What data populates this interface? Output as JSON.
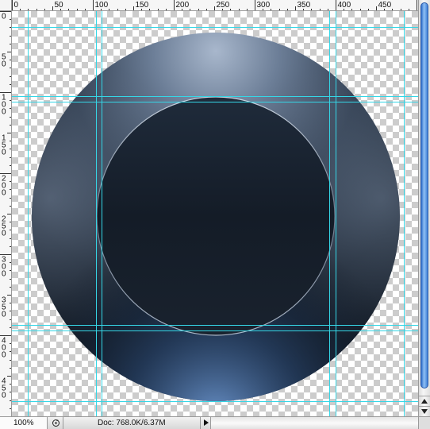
{
  "rulers": {
    "horizontal_labels": [
      "0",
      "50",
      "100",
      "150",
      "200",
      "250",
      "300",
      "350",
      "400",
      "450",
      "50"
    ],
    "vertical_labels": [
      "0",
      "5\n0",
      "1\n0\n0",
      "1\n5\n0",
      "2\n0\n0",
      "2\n5\n0",
      "3\n0\n0",
      "3\n5\n0",
      "4\n0\n0",
      "4\n5\n0",
      "5"
    ]
  },
  "colors": {
    "guide": "#35d6e6",
    "outer_disc_dark": "#111a26",
    "outer_disc_light": "#8a9bb3",
    "outer_rim_blue": "#5a87c0",
    "inner_disc_top": "#1e2a39",
    "inner_disc_bottom": "#121a25",
    "scroll_thumb": "#3f7fd6"
  },
  "status_bar": {
    "zoom": "100%",
    "doc_info": "Doc: 768.0K/6.37M",
    "nav_icon": "rotate-view-icon",
    "menu_icon": "triangle-right-icon"
  }
}
